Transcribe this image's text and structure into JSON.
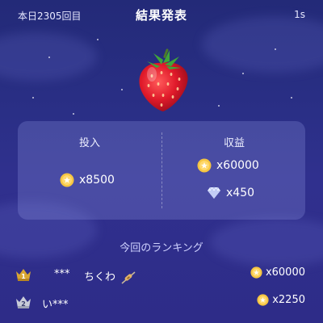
{
  "header": {
    "round_label": "本日2305回目",
    "title": "結果発表",
    "timer": "1s"
  },
  "result": {
    "fruit_icon": "strawberry-icon"
  },
  "summary": {
    "bet_heading": "投入",
    "bet_amount": "x8500",
    "earnings_heading": "収益",
    "earnings_coins": "x60000",
    "earnings_diamonds": "x450"
  },
  "ranking": {
    "title": "今回のランキング",
    "rows": [
      {
        "rank": "1",
        "name_prefix": "***",
        "name": "ちくわ",
        "name_icon": "chikuwa-skewer-icon",
        "amount": "x60000"
      },
      {
        "rank": "2",
        "name_prefix": "",
        "name": "い***",
        "name_icon": "",
        "amount": "x2250"
      }
    ]
  },
  "colors": {
    "background_top": "#232a78",
    "background_bottom": "#2e2c88",
    "card": "#8f98dc",
    "coin_gold": "#f5c542",
    "rank1_gold": "#d9a632",
    "rank2_silver": "#c9ccd8",
    "ranking_title": "#cfd2ff"
  }
}
